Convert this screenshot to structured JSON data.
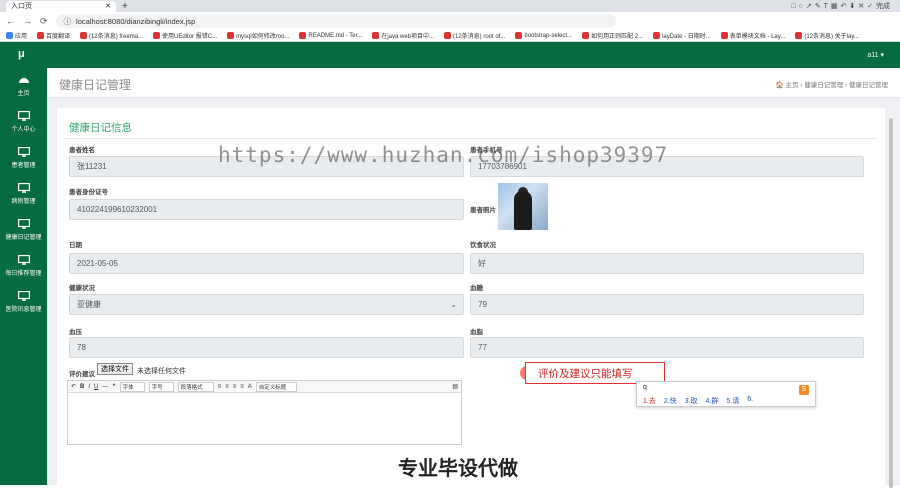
{
  "browser": {
    "tab_title": "入口页",
    "url": "localhost:8080/dianzibingli/index.jsp",
    "bookmarks": [
      "应用",
      "百度翻译",
      "(12条消息) freema...",
      "使用UEditor 报错C...",
      "mysql如何修改roo...",
      "README.md - Ter...",
      "在java web项目中...",
      "(12条消息) root of...",
      "bootstrap-select...",
      "如何用正则匹配 2...",
      "layDate - 日期时...",
      "表单模块文档 - Lay...",
      "(12条消息) 关于lay..."
    ],
    "annotation_font_size": "18",
    "annotation_text_label": "A",
    "annotation_done": "完成"
  },
  "app": {
    "logo": "μ",
    "user": "a11 ▾",
    "sidebar": [
      {
        "label": "主页",
        "icon": "dashboard-icon"
      },
      {
        "label": "个人中心",
        "icon": "monitor-icon"
      },
      {
        "label": "患者管理",
        "icon": "monitor-icon"
      },
      {
        "label": "病例管理",
        "icon": "monitor-icon"
      },
      {
        "label": "健康日记管理",
        "icon": "monitor-icon"
      },
      {
        "label": "每日推荐管理",
        "icon": "monitor-icon"
      },
      {
        "label": "医院讯息管理",
        "icon": "monitor-icon"
      }
    ],
    "page_title": "健康日记管理",
    "breadcrumb": "🏠 主页 › 健康日记管理 › 健康日记管理"
  },
  "form": {
    "title": "健康日记信息",
    "patient_name_label": "患者姓名",
    "patient_name": "张11231",
    "phone_label": "患者手机号",
    "phone": "17703786901",
    "id_label": "患者身份证号",
    "id_value": "410224199610232001",
    "photo_label": "患者照片",
    "date_label": "日期",
    "date_value": "2021-05-05",
    "diet_label": "饮食状况",
    "diet_value": "好",
    "health_label": "健康状况",
    "health_value": "亚健康",
    "blood_sugar_label": "血糖",
    "blood_sugar_value": "79",
    "bp_label": "血压",
    "bp_value": "78",
    "lipid_label": "血脂",
    "lipid_value": "77",
    "advice_label": "评价建议",
    "file_button": "选择文件",
    "file_none": "未选择任何文件",
    "editor_font": "字体",
    "editor_size": "字号",
    "editor_para": "段落格式",
    "editor_custom": "自定义标题"
  },
  "overlay": {
    "hint": "评价及建议只能填写",
    "ime_input": "q",
    "ime_candidates": [
      "1.去",
      "2.快",
      "3.取",
      "4.群",
      "5.请",
      "6."
    ],
    "watermark": "https://www.huzhan.com/ishop39397",
    "banner": "专业毕设代做"
  }
}
